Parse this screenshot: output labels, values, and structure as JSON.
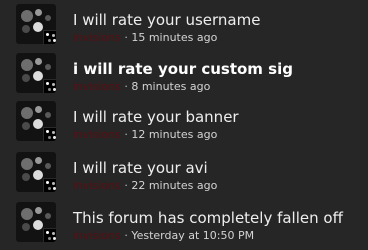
{
  "feed": {
    "items": [
      {
        "title": "I will rate your username",
        "author": "invisions",
        "separator": "·",
        "time": "15 minutes ago",
        "unread": false
      },
      {
        "title": "i will rate your custom sig",
        "author": "invisions",
        "separator": "·",
        "time": "8 minutes ago",
        "unread": true
      },
      {
        "title": "I will rate your banner",
        "author": "invisions",
        "separator": "·",
        "time": "12 minutes ago",
        "unread": false
      },
      {
        "title": "I will rate your avi",
        "author": "invisions",
        "separator": "·",
        "time": "22 minutes ago",
        "unread": false
      },
      {
        "title": "This forum has completely fallen off",
        "author": "invisions",
        "separator": "·",
        "time": "Yesterday at 10:50 PM",
        "unread": false
      }
    ]
  },
  "colors": {
    "background": "#262626",
    "author": "#5a0d12",
    "title": "#eeeeee"
  }
}
